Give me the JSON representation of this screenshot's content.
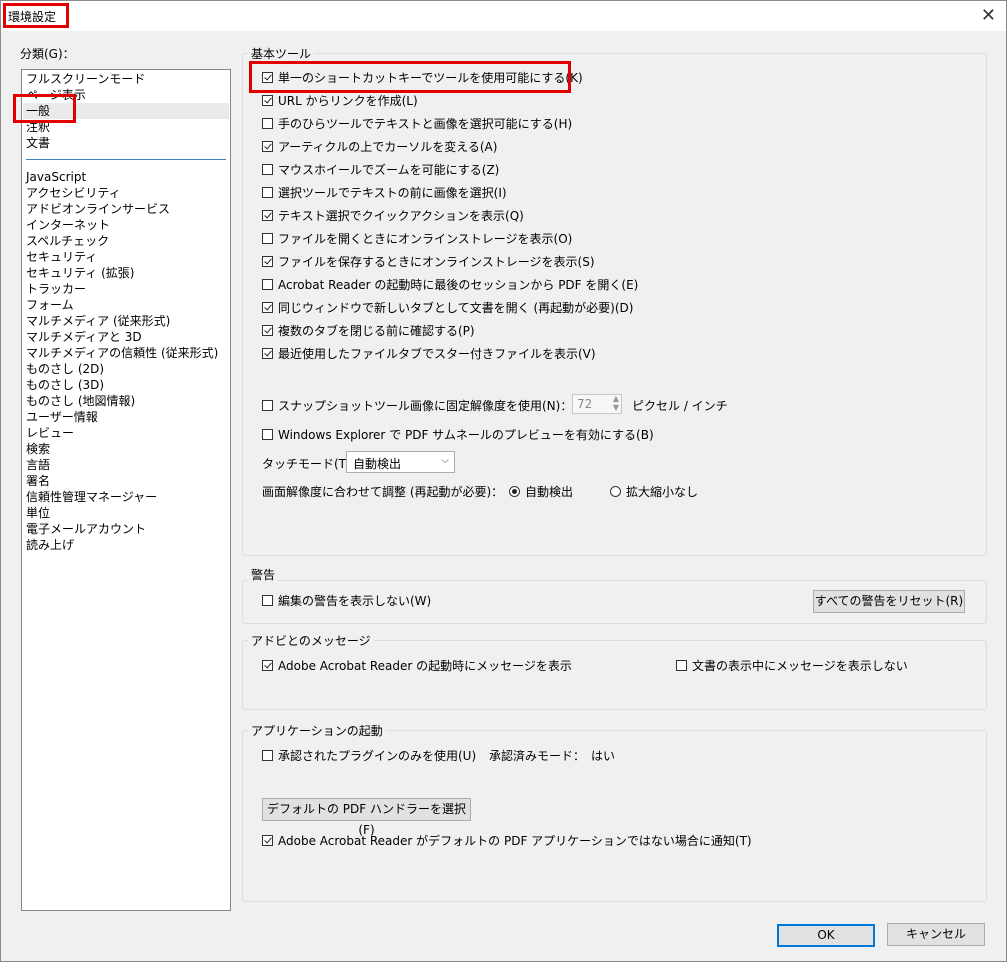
{
  "window": {
    "title": "環境設定",
    "close_glyph": "✕"
  },
  "categories": {
    "label": "分類(G)：",
    "top_items": [
      "フルスクリーンモード",
      "ページ表示",
      "一般",
      "注釈",
      "文書"
    ],
    "selected": "一般",
    "items": [
      "JavaScript",
      "アクセシビリティ",
      "アドビオンラインサービス",
      "インターネット",
      "スペルチェック",
      "セキュリティ",
      "セキュリティ (拡張)",
      "トラッカー",
      "フォーム",
      "マルチメディア (従来形式)",
      "マルチメディアと 3D",
      "マルチメディアの信頼性 (従来形式)",
      "ものさし (2D)",
      "ものさし (3D)",
      "ものさし (地図情報)",
      "ユーザー情報",
      "レビュー",
      "検索",
      "言語",
      "署名",
      "信頼性管理マネージャー",
      "単位",
      "電子メールアカウント",
      "読み上げ"
    ]
  },
  "basic_tools": {
    "title": "基本ツール",
    "options": [
      {
        "label": "単一のショートカットキーでツールを使用可能にする(K)",
        "checked": true
      },
      {
        "label": "URL からリンクを作成(L)",
        "checked": true
      },
      {
        "label": "手のひらツールでテキストと画像を選択可能にする(H)",
        "checked": false
      },
      {
        "label": "アーティクルの上でカーソルを変える(A)",
        "checked": true
      },
      {
        "label": "マウスホイールでズームを可能にする(Z)",
        "checked": false
      },
      {
        "label": "選択ツールでテキストの前に画像を選択(I)",
        "checked": false
      },
      {
        "label": "テキスト選択でクイックアクションを表示(Q)",
        "checked": true
      },
      {
        "label": "ファイルを開くときにオンラインストレージを表示(O)",
        "checked": false
      },
      {
        "label": "ファイルを保存するときにオンラインストレージを表示(S)",
        "checked": true
      },
      {
        "label": "Acrobat Reader の起動時に最後のセッションから PDF を開く(E)",
        "checked": false
      },
      {
        "label": "同じウィンドウで新しいタブとして文書を開く (再起動が必要)(D)",
        "checked": true
      },
      {
        "label": "複数のタブを閉じる前に確認する(P)",
        "checked": true
      },
      {
        "label": "最近使用したファイルタブでスター付きファイルを表示(V)",
        "checked": true
      }
    ],
    "snapshot": {
      "label": "スナップショットツール画像に固定解像度を使用(N)：",
      "checked": false,
      "value": "72",
      "unit": "ピクセル / インチ"
    },
    "thumbnail": {
      "label": "Windows Explorer で PDF サムネールのプレビューを有効にする(B)",
      "checked": false
    },
    "touch_mode": {
      "label": "タッチモード(T)：",
      "value": "自動検出"
    },
    "scaling": {
      "label": "画面解像度に合わせて調整 (再起動が必要)：",
      "options": [
        {
          "label": "自動検出",
          "selected": true
        },
        {
          "label": "拡大縮小なし",
          "selected": false
        }
      ]
    }
  },
  "warnings": {
    "title": "警告",
    "option": {
      "label": "編集の警告を表示しない(W)",
      "checked": false
    },
    "reset_button": "すべての警告をリセット(R)"
  },
  "adobe_messages": {
    "title": "アドビとのメッセージ",
    "options": [
      {
        "label": "Adobe Acrobat Reader の起動時にメッセージを表示",
        "checked": true
      },
      {
        "label": "文書の表示中にメッセージを表示しない",
        "checked": false
      }
    ]
  },
  "app_startup": {
    "title": "アプリケーションの起動",
    "certified_only": {
      "label": "承認されたプラグインのみを使用(U)",
      "checked": false
    },
    "certified_mode": "承認済みモード：　はい",
    "default_pdf_button": "デフォルトの PDF ハンドラーを選択(F)",
    "notify": {
      "label": "Adobe Acrobat Reader がデフォルトの PDF アプリケーションではない場合に通知(T)",
      "checked": true
    }
  },
  "footer": {
    "ok": "OK",
    "cancel": "キャンセル"
  },
  "colors": {
    "highlight": "#e00000",
    "separator": "#3b7fc4",
    "default_button": "#0078d7"
  }
}
